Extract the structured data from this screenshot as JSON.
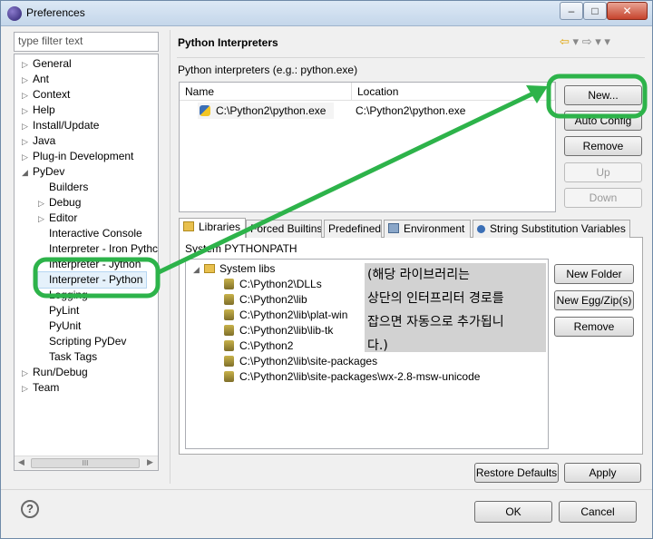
{
  "window": {
    "title": "Preferences"
  },
  "filter": {
    "placeholder": "type filter text"
  },
  "tree": {
    "items": [
      {
        "label": "General",
        "expander": "▷"
      },
      {
        "label": "Ant",
        "expander": "▷"
      },
      {
        "label": "Context",
        "expander": "▷"
      },
      {
        "label": "Help",
        "expander": "▷"
      },
      {
        "label": "Install/Update",
        "expander": "▷"
      },
      {
        "label": "Java",
        "expander": "▷"
      },
      {
        "label": "Plug-in Development",
        "expander": "▷"
      },
      {
        "label": "PyDev",
        "expander": "◢"
      },
      {
        "label": "Builders",
        "expander": ""
      },
      {
        "label": "Debug",
        "expander": "▷"
      },
      {
        "label": "Editor",
        "expander": "▷"
      },
      {
        "label": "Interactive Console",
        "expander": ""
      },
      {
        "label": "Interpreter - Iron Pythc",
        "expander": ""
      },
      {
        "label": "Interpreter - Jython",
        "expander": ""
      },
      {
        "label": "Interpreter - Python",
        "expander": ""
      },
      {
        "label": "Logging",
        "expander": ""
      },
      {
        "label": "PyLint",
        "expander": ""
      },
      {
        "label": "PyUnit",
        "expander": ""
      },
      {
        "label": "Scripting PyDev",
        "expander": ""
      },
      {
        "label": "Task Tags",
        "expander": ""
      },
      {
        "label": "Run/Debug",
        "expander": "▷"
      },
      {
        "label": "Team",
        "expander": "▷"
      }
    ],
    "selected": "Interpreter - Python",
    "scroll_thumb": "III"
  },
  "page": {
    "title": "Python Interpreters",
    "subtitle": "Python interpreters (e.g.: python.exe)",
    "nav": {
      "back": "⇦",
      "fwd": "⇨",
      "drop": "▾",
      "menu": "▾"
    }
  },
  "interpreters": {
    "columns": [
      "Name",
      "Location"
    ],
    "rows": [
      {
        "name": "C:\\Python2\\python.exe",
        "location": "C:\\Python2\\python.exe"
      }
    ]
  },
  "interp_buttons": {
    "new": "New...",
    "auto": "Auto Config",
    "remove": "Remove",
    "up": "Up",
    "down": "Down"
  },
  "tabs": [
    "Libraries",
    "Forced Builtins",
    "Predefined",
    "Environment",
    "String Substitution Variables"
  ],
  "libraries": {
    "label": "System PYTHONPATH",
    "root": "System libs",
    "items": [
      "C:\\Python2\\DLLs",
      "C:\\Python2\\lib",
      "C:\\Python2\\lib\\plat-win",
      "C:\\Python2\\lib\\lib-tk",
      "C:\\Python2",
      "C:\\Python2\\lib\\site-packages",
      "C:\\Python2\\lib\\site-packages\\wx-2.8-msw-unicode"
    ]
  },
  "lib_buttons": {
    "new_folder": "New Folder",
    "new_egg": "New Egg/Zip(s)",
    "remove": "Remove"
  },
  "note": [
    "(해당 라이브러리는",
    "상단의 인터프리터 경로를",
    "잡으면 자동으로 추가됩니",
    "다.)"
  ],
  "footer": {
    "restore": "Restore Defaults",
    "apply": "Apply",
    "ok": "OK",
    "cancel": "Cancel",
    "help": "?"
  },
  "colors": {
    "annotation_green": "#2db34a",
    "note_bg": "#d2d2d2"
  }
}
